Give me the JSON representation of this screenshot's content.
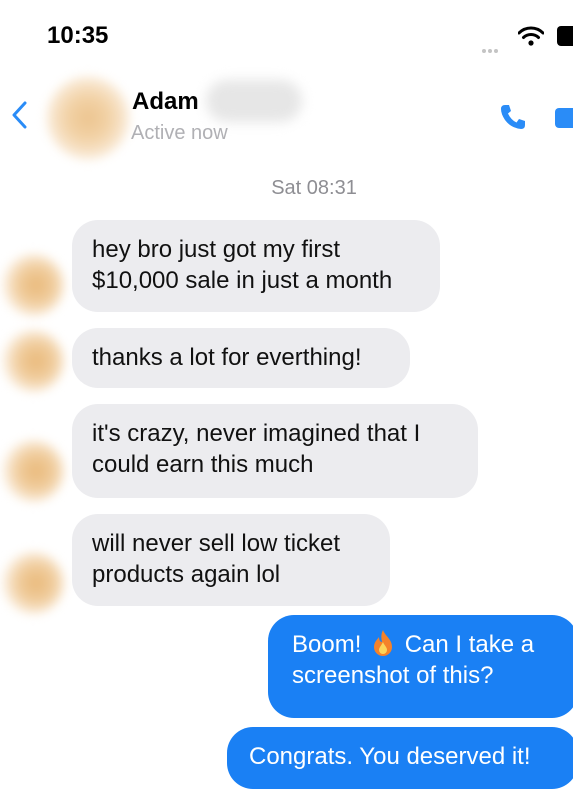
{
  "status_bar": {
    "time": "10:35"
  },
  "header": {
    "contact_name": "Adam",
    "status": "Active now"
  },
  "conversation": {
    "timestamp": "Sat 08:31",
    "received_messages": [
      "hey bro just got my first\n$10,000 sale in just a month",
      "thanks a lot for everthing!",
      "it's crazy, never imagined that I\ncould earn this much",
      "will never sell low ticket\nproducts again lol"
    ],
    "sent_messages": [
      {
        "before_emoji": "Boom! ",
        "emoji": "fire-icon",
        "after_emoji": " Can I take a\nscreenshot of this?"
      },
      {
        "text": "Congrats. You deserved it!"
      }
    ]
  },
  "colors": {
    "sent_bubble": "#1a80f4",
    "received_bubble": "#ececef",
    "accent_blue": "#2a8cf7",
    "secondary_text": "#8e8e93"
  }
}
